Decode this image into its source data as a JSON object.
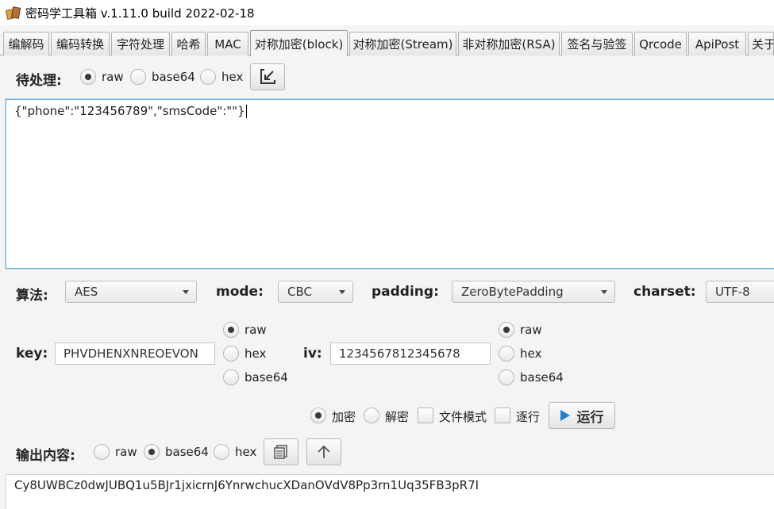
{
  "window": {
    "title": "密码学工具箱 v.1.11.0 build 2022-02-18",
    "icon": "app-books-icon"
  },
  "tabs": [
    {
      "label": "编解码"
    },
    {
      "label": "编码转换"
    },
    {
      "label": "字符处理"
    },
    {
      "label": "哈希"
    },
    {
      "label": "MAC"
    },
    {
      "label": "对称加密(block)",
      "active": true
    },
    {
      "label": "对称加密(Stream)"
    },
    {
      "label": "非对称加密(RSA)"
    },
    {
      "label": "签名与验签"
    },
    {
      "label": "Qrcode"
    },
    {
      "label": "ApiPost"
    },
    {
      "label": "关于"
    }
  ],
  "input": {
    "label": "待处理:",
    "formats": [
      "raw",
      "base64",
      "hex"
    ],
    "selected_format": "raw",
    "import_icon": "import-arrow-icon",
    "value": "{\"phone\":\"123456789\",\"smsCode\":\"\"}"
  },
  "settings": {
    "algorithm_label": "算法:",
    "algorithm_value": "AES",
    "mode_label": "mode:",
    "mode_value": "CBC",
    "padding_label": "padding:",
    "padding_value": "ZeroBytePadding",
    "charset_label": "charset:",
    "charset_value": "UTF-8"
  },
  "key": {
    "label": "key:",
    "value": "PHVDHENXNREOEVON",
    "formats": [
      "raw",
      "hex",
      "base64"
    ],
    "selected_format": "raw"
  },
  "iv": {
    "label": "iv:",
    "value": "1234567812345678",
    "formats": [
      "raw",
      "hex",
      "base64"
    ],
    "selected_format": "raw"
  },
  "actions": {
    "encrypt_label": "加密",
    "decrypt_label": "解密",
    "selected": "encrypt",
    "file_mode_label": "文件模式",
    "line_by_line_label": "逐行",
    "run_label": "运行",
    "run_icon": "play-icon"
  },
  "output": {
    "label": "输出内容:",
    "formats": [
      "raw",
      "base64",
      "hex"
    ],
    "selected_format": "base64",
    "copy_icon": "copy-icon",
    "up_icon": "arrow-up-icon",
    "value": "Cy8UWBCz0dwJUBQ1u5BJr1jxicrnJ6YnrwchucXDanOVdV8Pp3rn1Uq35FB3pR7I"
  },
  "colors": {
    "focus_border": "#6aaee4",
    "run_icon": "#1e7fd8"
  }
}
